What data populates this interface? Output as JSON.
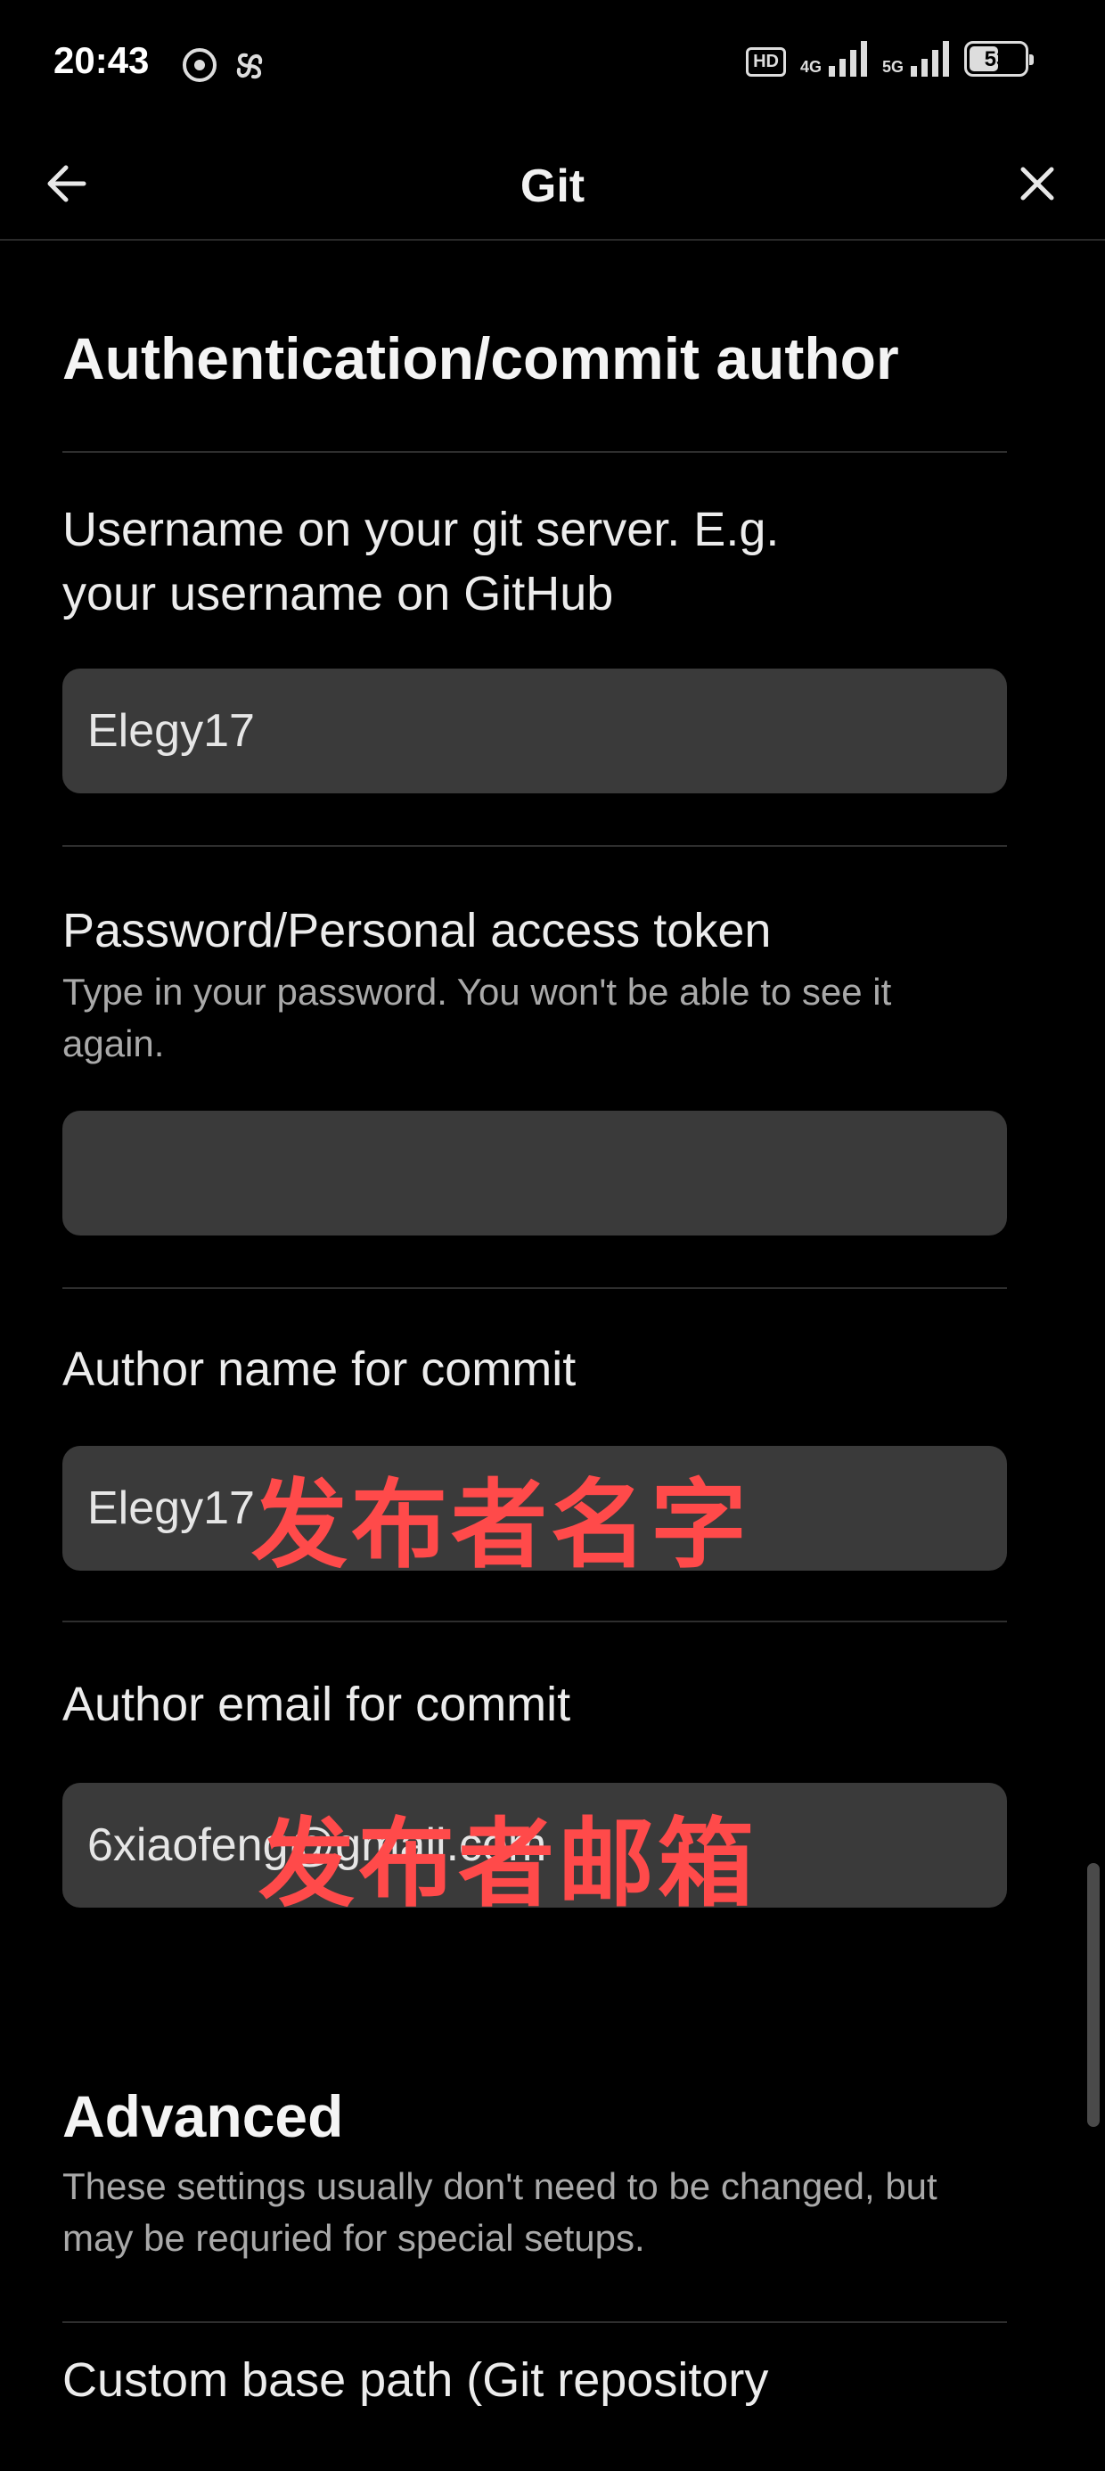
{
  "status_bar": {
    "time": "20:43",
    "icons": [
      "screen-record-icon",
      "pinwheel-icon"
    ],
    "hd_badge": "HD",
    "sim1_network": "4G",
    "sim2_network": "5G",
    "battery_level": "53"
  },
  "header": {
    "title": "Git",
    "back_icon": "arrow-left-icon",
    "close_icon": "close-icon"
  },
  "auth_section": {
    "title": "Authentication/commit author",
    "username": {
      "label": "Username on your git server. E.g. your username on GitHub",
      "value": "Elegy17"
    },
    "password": {
      "label": "Password/Personal access token",
      "help": "Type in your password. You won't be able to see it again.",
      "value": ""
    },
    "author_name": {
      "label": "Author name for commit",
      "value": "Elegy17",
      "annotation": "发布者名字"
    },
    "author_email": {
      "label": "Author email for commit",
      "value": "6xiaofeng@gmail.com",
      "annotation": "发布者邮箱"
    }
  },
  "advanced_section": {
    "title": "Advanced",
    "help": "These settings usually don't need to be changed, but may be requried for special setups.",
    "custom_base_path_label": "Custom base path (Git repository"
  },
  "colors": {
    "background": "#000000",
    "field_background": "#3a3a3a",
    "annotation": "#ff4a4a"
  }
}
